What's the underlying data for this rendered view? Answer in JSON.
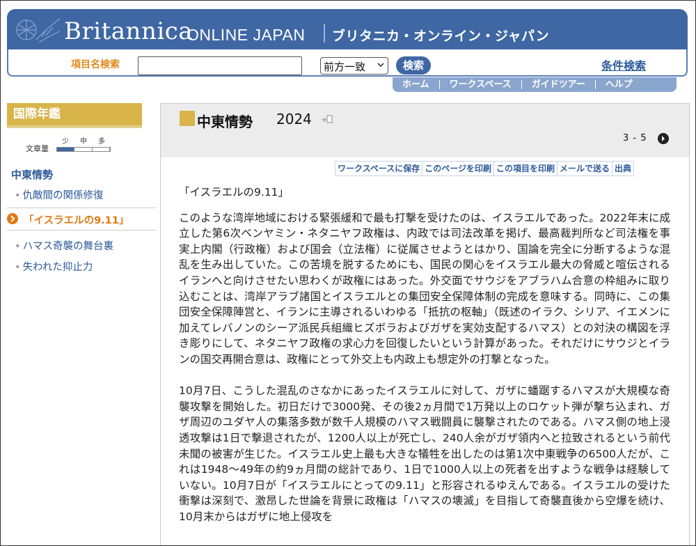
{
  "header": {
    "brand": "Britannica",
    "brand_sub": "ONLINE JAPAN",
    "brand_ja": "ブリタニカ・オンライン・ジャパン",
    "colors": {
      "banner": "#3f67a3",
      "accent_orange": "#e07a10",
      "gold": "#d9b44a",
      "link": "#2d5a9a"
    }
  },
  "search": {
    "label": "項目名検索",
    "input_value": "",
    "match_mode": "前方一致",
    "button": "検索",
    "advanced": "条件検索"
  },
  "nav": [
    "ホーム",
    "ワークスペース",
    "ガイドツアー",
    "ヘルプ"
  ],
  "sidebar": {
    "title": "国際年鑑",
    "text_size_label": "文章量",
    "text_size_options": [
      "少",
      "中",
      "多"
    ],
    "section": "中東情勢",
    "items": [
      {
        "label": "仇敵間の関係修復"
      },
      {
        "label": "「イスラエルの9.11」",
        "current": true
      },
      {
        "label": "ハマス奇襲の舞台裏"
      },
      {
        "label": "失われた抑止力"
      }
    ]
  },
  "article": {
    "title": "中東情勢",
    "year": "2024",
    "pager": "3 - 5",
    "tools": [
      "ワークスペースに保存",
      "このページを印刷",
      "この項目を印刷",
      "メールで送る",
      "出典"
    ],
    "heading": "「イスラエルの9.11」",
    "paragraphs": [
      "このような湾岸地域における緊張緩和で最も打撃を受けたのは、イスラエルであった。2022年末に成立した第6次ベンヤミン・ネタニヤフ政権は、内政では司法改革を掲げ、最高裁判所など司法権を事実上内閣（行政権）および国会（立法権）に従属させようとはかり、国論を完全に分断するような混乱を生み出していた。この苦境を脱するためにも、国民の関心をイスラエル最大の脅威と喧伝されるイランへと向けさせたい思わくが政権にはあった。外交面でサウジをアブラハム合意の枠組みに取り込むことは、湾岸アラブ諸国とイスラエルとの集団安全保障体制の完成を意味する。同時に、この集団安全保障陣営と、イランに主導されるいわゆる「抵抗の枢軸」（既述のイラク、シリア、イエメンに加えてレバノンのシーア派民兵組織ヒズボラおよびガザを実効支配するハマス）との対決の構図を浮き彫りにして、ネタニヤフ政権の求心力を回復したいという計算があった。それだけにサウジとイランの国交再開合意は、政権にとって外交上も内政上も想定外の打撃となった。",
      "10月7日、こうした混乱のさなかにあったイスラエルに対して、ガザに蟠踞するハマスが大規模な奇襲攻撃を開始した。初日だけで3000発、その後2ヵ月間で1万発以上のロケット弾が撃ち込まれ、ガザ周辺のユダヤ人の集落多数が数千人規模のハマス戦闘員に襲撃されたのである。ハマス側の地上浸透攻撃は1日で撃退されたが、1200人以上が死亡し、240人余がガザ領内へと拉致されるという前代未聞の被害が生じた。イスラエル史上最も大きな犠牲を出したのは第1次中東戦争の6500人だが、これは1948〜49年の約9ヵ月間の総計であり、1日で1000人以上の死者を出すような戦争は経験していない。10月7日が「イスラエルにとっての9.11」と形容されるゆえんである。イスラエルの受けた衝撃は深刻で、激昂した世論を背景に政権は「ハマスの壊滅」を目指して奇襲直後から空爆を続け、10月末からはガザに地上侵攻を"
    ]
  }
}
